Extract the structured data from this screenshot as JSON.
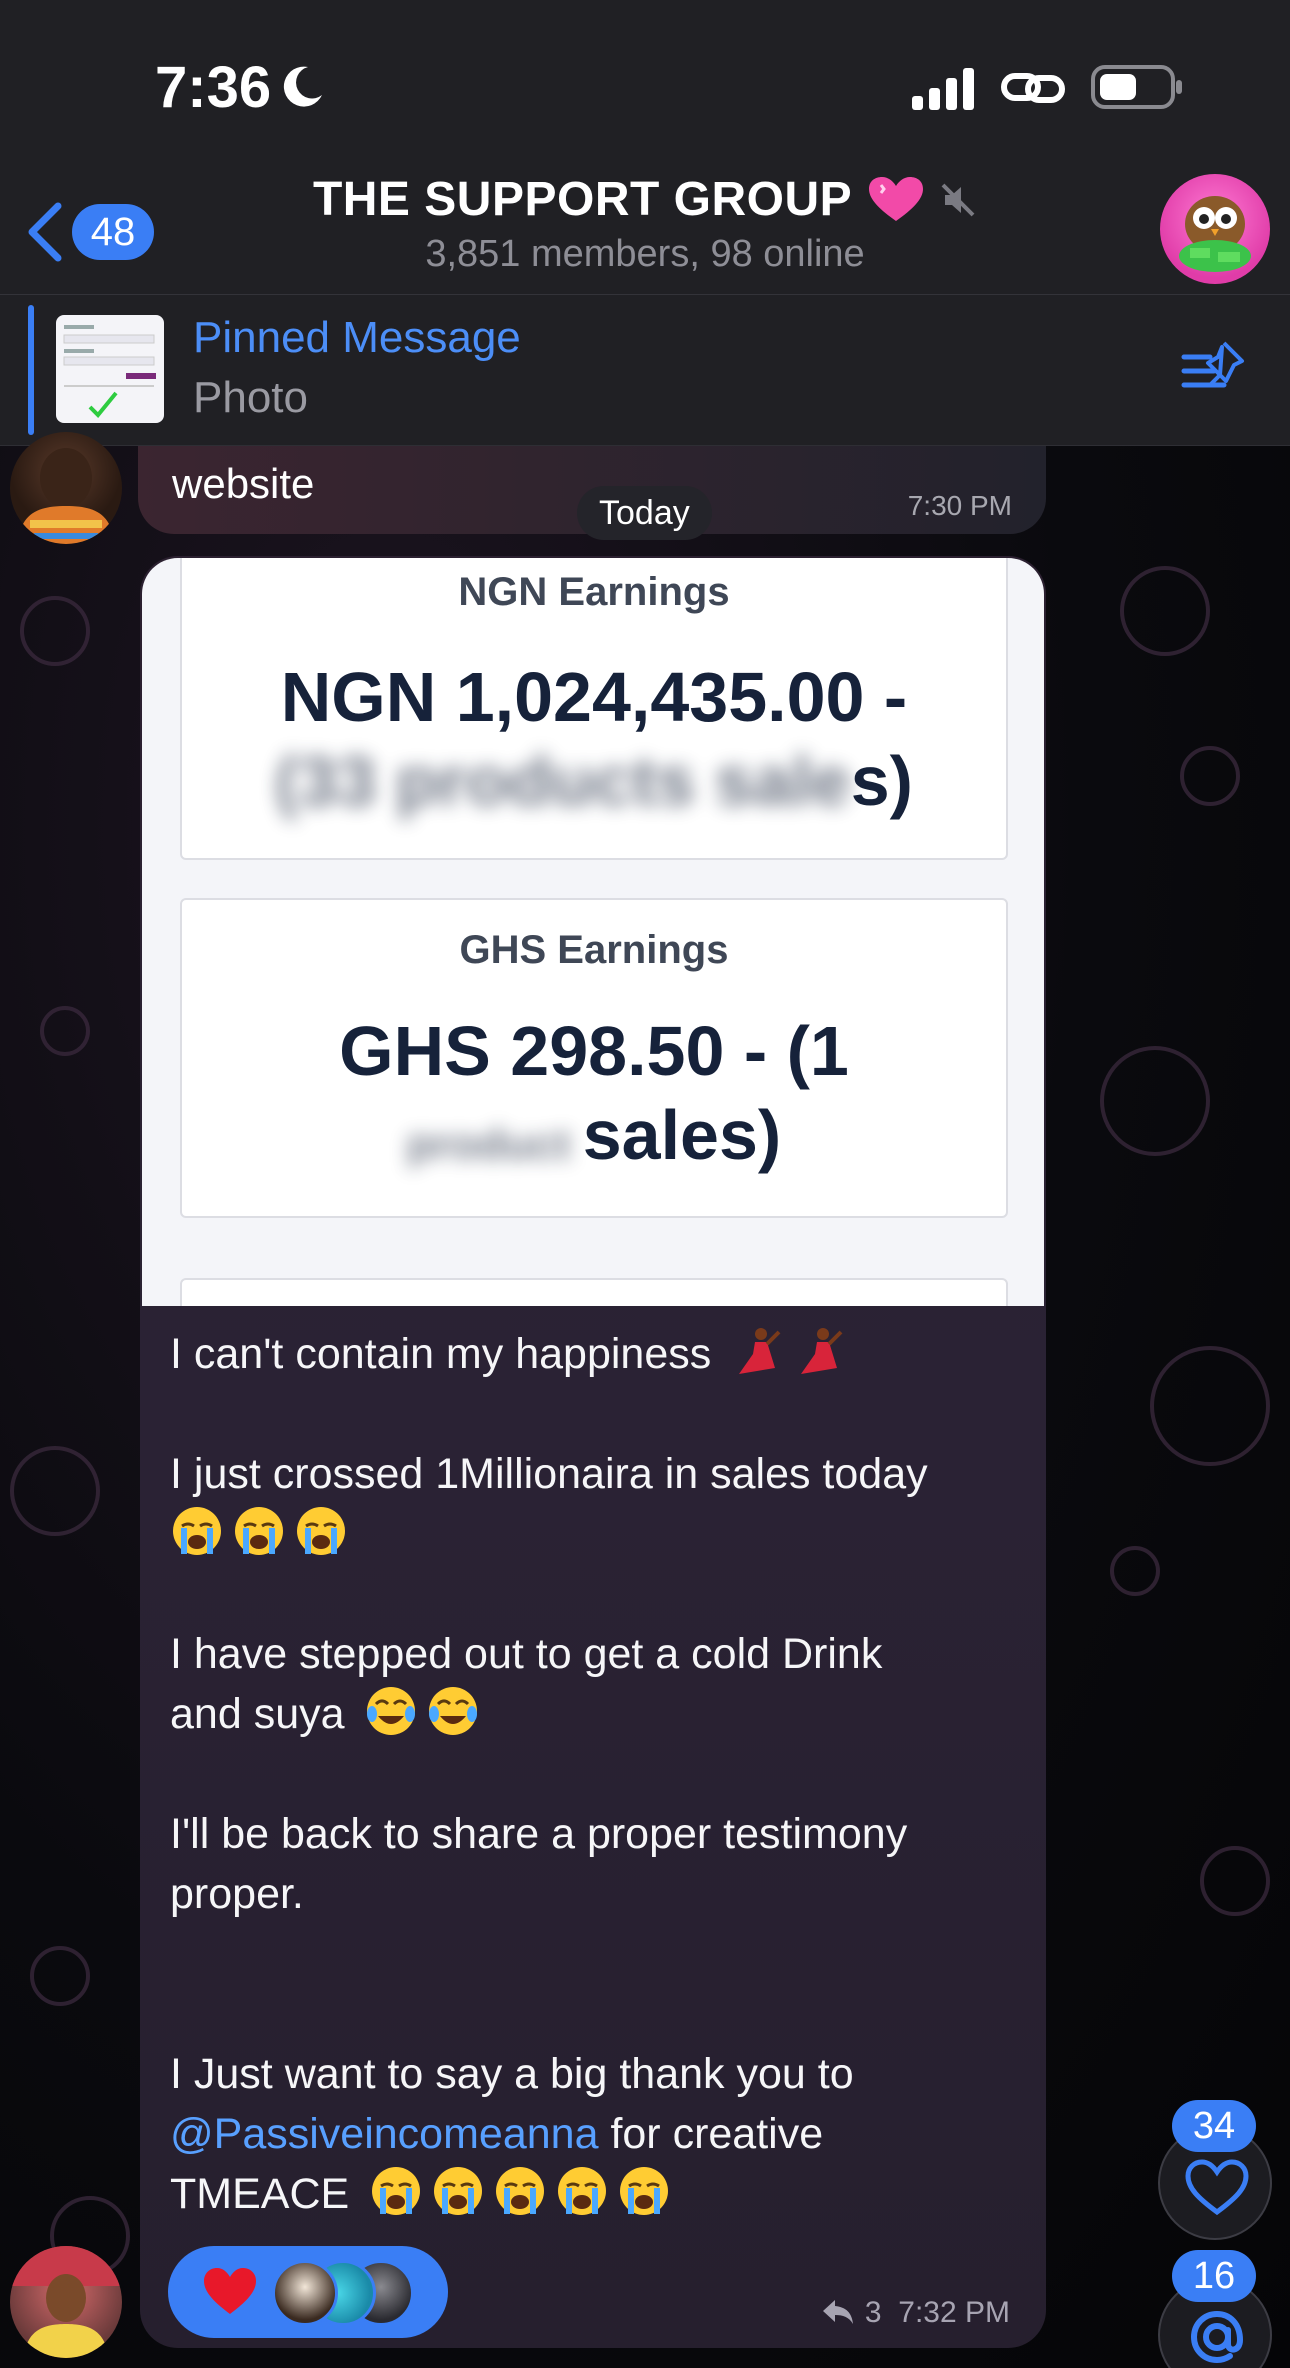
{
  "status_bar": {
    "time": "7:36"
  },
  "header": {
    "back_count": "48",
    "title": "THE SUPPORT GROUP",
    "subtitle": "3,851 members, 98 online"
  },
  "pinned": {
    "title": "Pinned Message",
    "subtitle": "Photo"
  },
  "messages": {
    "previous": {
      "text": "website",
      "time": "7:30 PM"
    },
    "date_divider": "Today",
    "main": {
      "photo": {
        "ngn_label": "NGN Earnings",
        "ngn_amount_line1": "NGN 1,024,435.00 -",
        "ngn_amount_line2_visible": "s)",
        "ghs_label": "GHS Earnings",
        "ghs_amount_line1": "GHS 298.50 - (1",
        "ghs_amount_line2_visible": "sales)"
      },
      "lines": {
        "l1": "I can't contain my happiness",
        "l2": "I just crossed 1Millionaira in sales today",
        "l3": "I have stepped out to get a cold Drink",
        "l4": "and suya",
        "l5": "I'll be back to share a proper testimony",
        "l6": "proper.",
        "l7": "I Just want to say a big thank  you to",
        "l8_mention": "@Passiveincomeanna",
        "l8_rest": " for creative",
        "l9": "TMEACE"
      },
      "reply_count": "3",
      "time": "7:32 PM"
    }
  },
  "floating": {
    "reactions_badge": "34",
    "mentions_badge": "16"
  },
  "colors": {
    "accent": "#3a7ef5",
    "mention": "#58a0ff",
    "header_bg": "#202024"
  }
}
